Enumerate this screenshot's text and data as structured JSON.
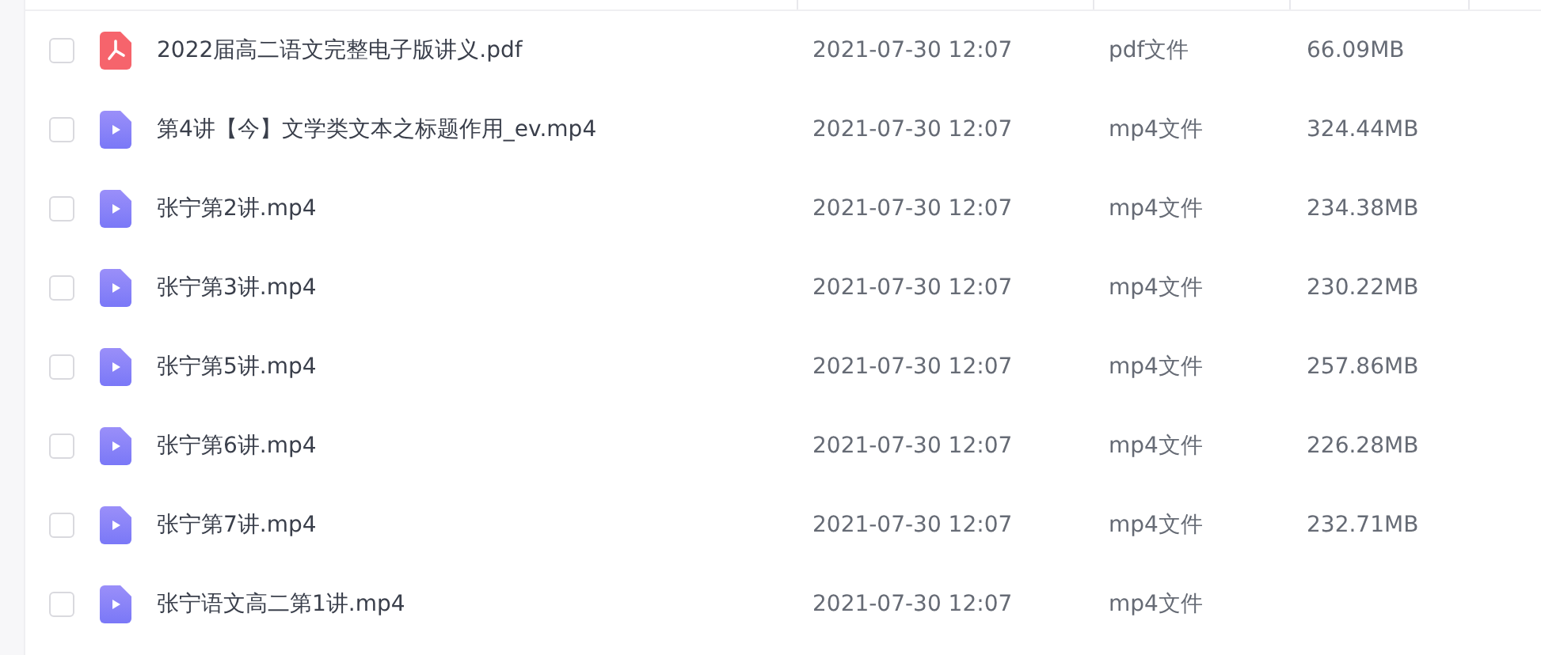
{
  "files": [
    {
      "kind": "pdf",
      "checked": false,
      "name": "2022届高二语文完整电子版讲义.pdf",
      "modified": "2021-07-30 12:07",
      "type": "pdf文件",
      "size": "66.09MB"
    },
    {
      "kind": "video",
      "checked": false,
      "name": "第4讲【今】文学类文本之标题作用_ev.mp4",
      "modified": "2021-07-30 12:07",
      "type": "mp4文件",
      "size": "324.44MB"
    },
    {
      "kind": "video",
      "checked": false,
      "name": "张宁第2讲.mp4",
      "modified": "2021-07-30 12:07",
      "type": "mp4文件",
      "size": "234.38MB"
    },
    {
      "kind": "video",
      "checked": false,
      "name": "张宁第3讲.mp4",
      "modified": "2021-07-30 12:07",
      "type": "mp4文件",
      "size": "230.22MB"
    },
    {
      "kind": "video",
      "checked": false,
      "name": "张宁第5讲.mp4",
      "modified": "2021-07-30 12:07",
      "type": "mp4文件",
      "size": "257.86MB"
    },
    {
      "kind": "video",
      "checked": false,
      "name": "张宁第6讲.mp4",
      "modified": "2021-07-30 12:07",
      "type": "mp4文件",
      "size": "226.28MB"
    },
    {
      "kind": "video",
      "checked": false,
      "name": "张宁第7讲.mp4",
      "modified": "2021-07-30 12:07",
      "type": "mp4文件",
      "size": "232.71MB"
    },
    {
      "kind": "video",
      "checked": false,
      "name": "张宁语文高二第1讲.mp4",
      "modified": "2021-07-30 12:07",
      "type": "mp4文件"
    }
  ]
}
